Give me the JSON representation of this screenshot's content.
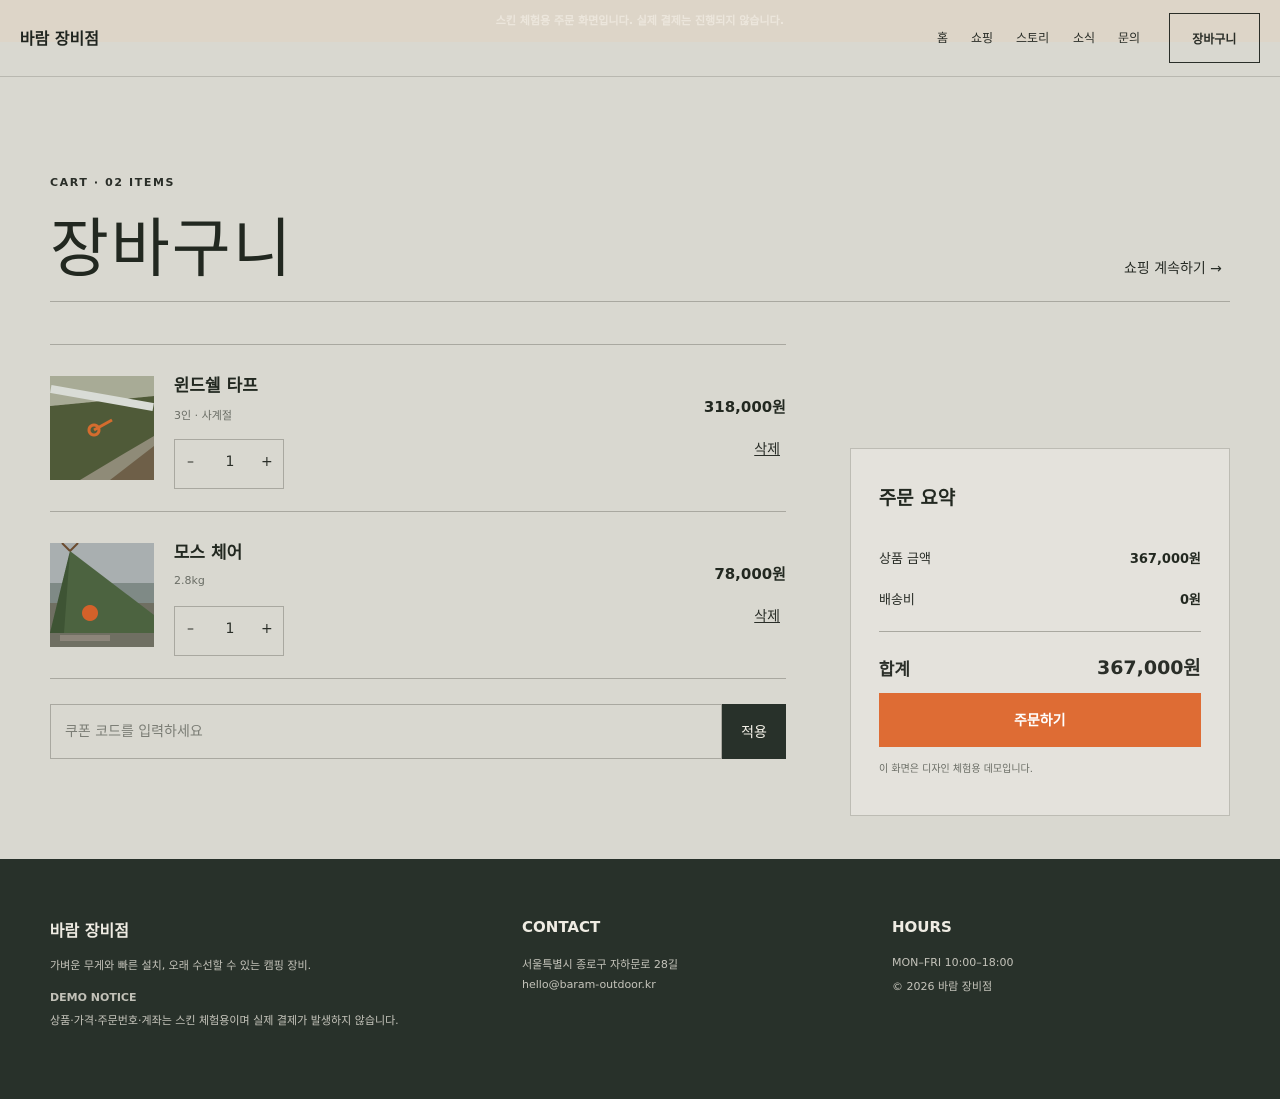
{
  "notice": "스킨 체험용 주문 화면입니다. 실제 결제는 진행되지 않습니다.",
  "header": {
    "logo": "바람 장비점",
    "nav": [
      "홈",
      "쇼핑",
      "스토리",
      "소식",
      "문의"
    ],
    "cart_button": "장바구니"
  },
  "page": {
    "eyebrow": "CART · 02 ITEMS",
    "title": "장바구니",
    "continue_link": "쇼핑 계속하기 →"
  },
  "cart": {
    "items": [
      {
        "name": "윈드쉘 타프",
        "option": "3인 · 사계절",
        "quantity": "1",
        "price": "318,000원",
        "delete": "삭제",
        "minus": "–",
        "plus": "+"
      },
      {
        "name": "모스 체어",
        "option": "2.8kg",
        "quantity": "1",
        "price": "78,000원",
        "delete": "삭제",
        "minus": "–",
        "plus": "+"
      }
    ],
    "coupon_placeholder": "쿠폰 코드를 입력하세요",
    "coupon_button": "적용"
  },
  "summary": {
    "title": "주문 요약",
    "subtotal_label": "상품 금액",
    "subtotal_value": "367,000원",
    "shipping_label": "배송비",
    "shipping_value": "0원",
    "total_label": "합계",
    "total_value": "367,000원",
    "order_button": "주문하기",
    "note": "이 화면은 디자인 체험용 데모입니다."
  },
  "footer": {
    "logo": "바람 장비점",
    "tagline": "가벼운 무게와 빠른 설치, 오래 수선할 수 있는 캠핑 장비.",
    "demo_notice_title": "DEMO NOTICE",
    "demo_notice_text": "상품·가격·주문번호·계좌는 스킨 체험용이며 실제 결제가 발생하지 않습니다.",
    "contact_title": "CONTACT",
    "address": "서울특별시 종로구 자하문로 28길",
    "email": "hello@baram-outdoor.kr",
    "hours_title": "HOURS",
    "hours": "MON–FRI 10:00–18:00",
    "copyright": "© 2026 바람 장비점"
  },
  "colors": {
    "background": "#d9d8d0",
    "accent": "#de6c34",
    "dark": "#28312a"
  }
}
